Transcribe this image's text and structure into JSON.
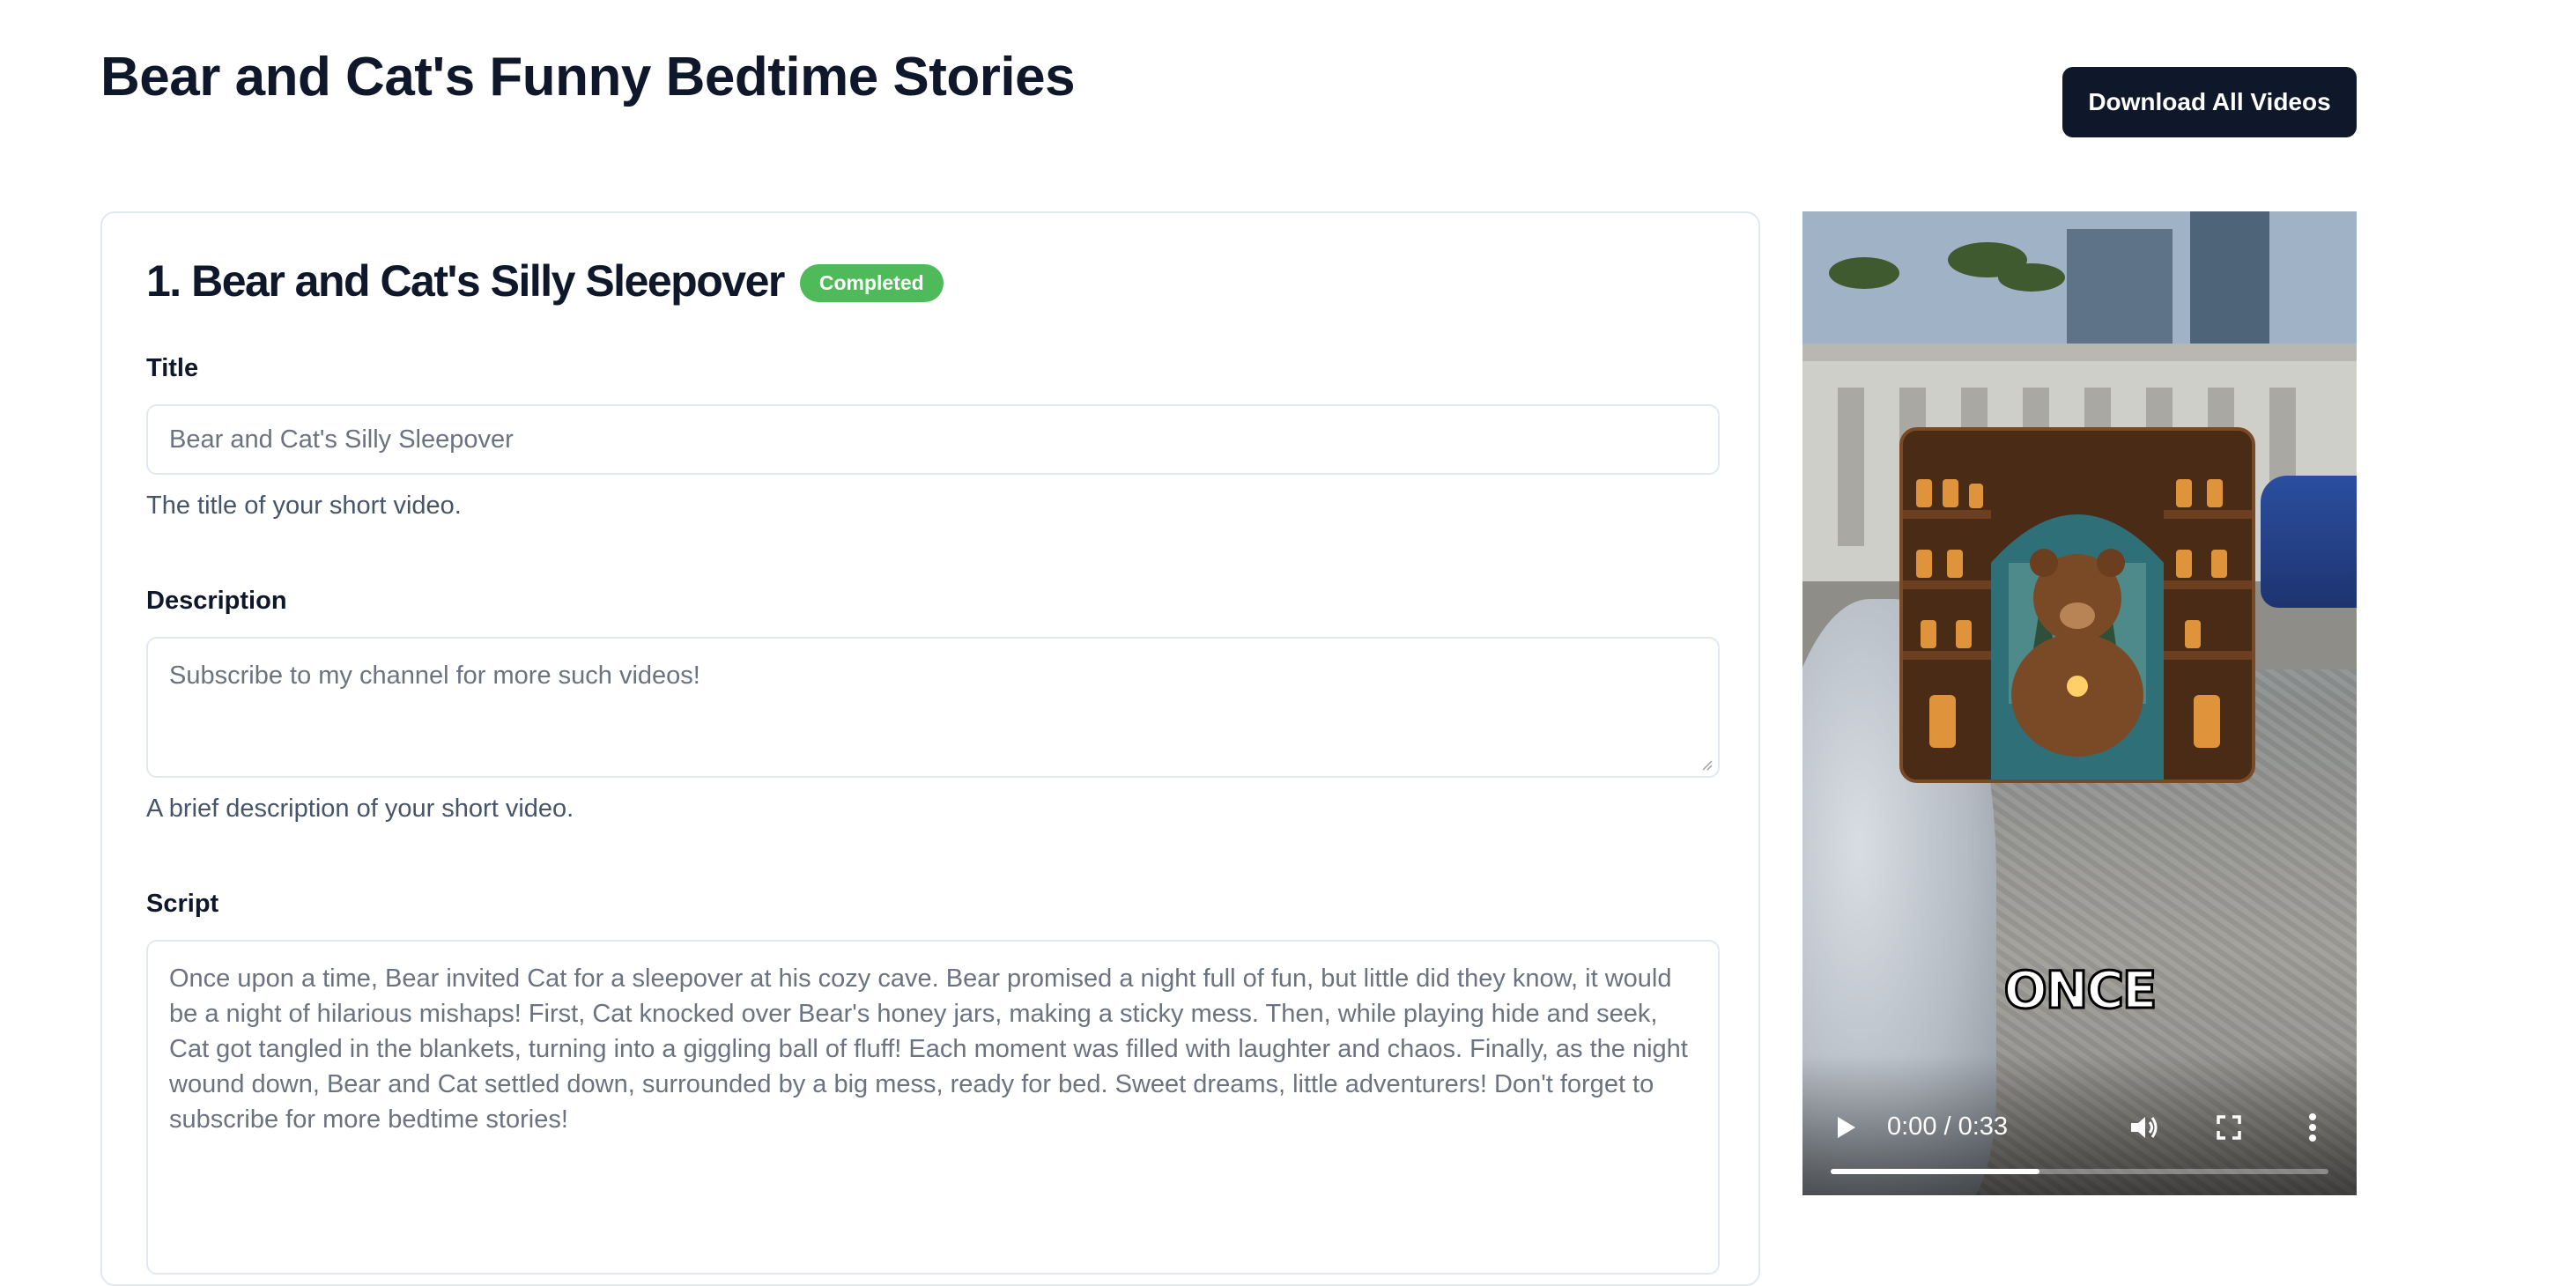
{
  "header": {
    "title": "Bear and Cat's Funny Bedtime Stories",
    "download_label": "Download All Videos"
  },
  "story": {
    "heading": "1. Bear and Cat's Silly Sleepover",
    "status": "Completed",
    "title_label": "Title",
    "title_value": "Bear and Cat's Silly Sleepover",
    "title_hint": "The title of your short video.",
    "description_label": "Description",
    "description_value": "Subscribe to my channel for more such videos!",
    "description_hint": "A brief description of your short video.",
    "script_label": "Script",
    "script_value": "Once upon a time, Bear invited Cat for a sleepover at his cozy cave. Bear promised a night full of fun, but little did they know, it would be a night of hilarious mishaps! First, Cat knocked over Bear's honey jars, making a sticky mess. Then, while playing hide and seek, Cat got tangled in the blankets, turning into a giggling ball of fluff! Each moment was filled with laughter and chaos. Finally, as the night wound down, Bear and Cat settled down, surrounded by a big mess, ready for bed. Sweet dreams, little adventurers! Don't forget to subscribe for more bedtime stories!"
  },
  "video": {
    "caption": "ONCE",
    "time": "0:00 / 0:33",
    "buffered_fraction": 0.42,
    "icons": [
      "play-icon",
      "volume-icon",
      "fullscreen-icon",
      "more-options-icon"
    ]
  },
  "colors": {
    "primary_button": "#0f172a",
    "badge": "#4fba5a",
    "border": "#e2e8f0",
    "hint_text": "#475569"
  }
}
